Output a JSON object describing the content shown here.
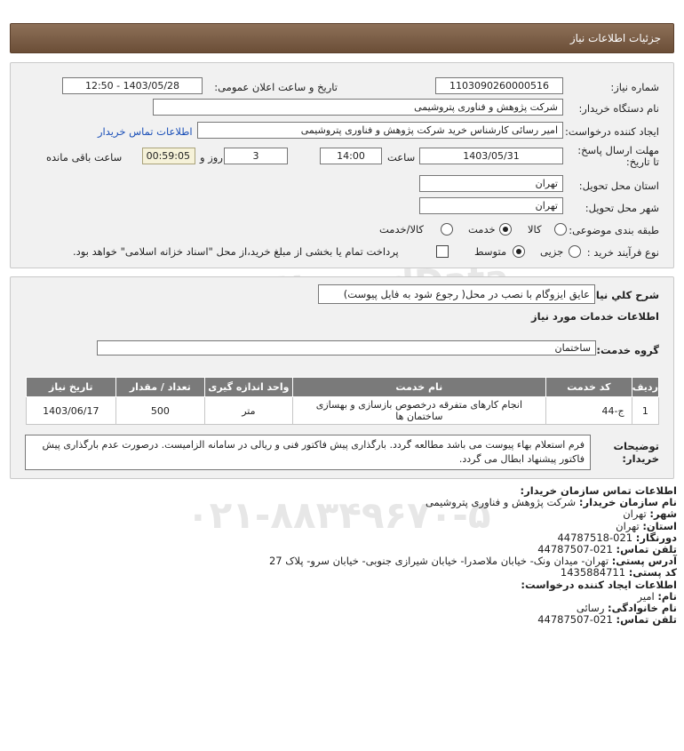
{
  "header": {
    "title": "جزئیات اطلاعات نیاز"
  },
  "form": {
    "need_number_label": "شماره نیاز:",
    "need_number": "1103090260000516",
    "announce_label": "تاریخ و ساعت اعلان عمومی:",
    "announce_value": "1403/05/28 - 12:50",
    "buyer_org_label": "نام دستگاه خریدار:",
    "buyer_org": "شرکت پژوهش و فناوری پتروشیمی",
    "creator_label": "ایجاد کننده درخواست:",
    "creator": "امیر رسائی کارشناس خرید شرکت پژوهش و فناوری پتروشیمی",
    "buyer_contact_link": "اطلاعات تماس خریدار",
    "deadline_label": "مهلت ارسال پاسخ: تا تاریخ:",
    "deadline_date": "1403/05/31",
    "time_label": "ساعت",
    "deadline_time": "14:00",
    "days_value": "3",
    "days_label": "روز و",
    "remaining_time": "00:59:05",
    "remaining_label": "ساعت باقی مانده",
    "province_label": "استان محل تحویل:",
    "province": "تهران",
    "city_label": "شهر محل تحویل:",
    "city": "تهران",
    "category_label": "طبقه بندی موضوعی:",
    "category_options": [
      "کالا",
      "خدمت",
      "کالا/خدمت"
    ],
    "process_label": "نوع فرآیند خرید :",
    "process_options": [
      "جزیی",
      "متوسط"
    ],
    "payment_note": "پرداخت تمام یا بخشی از مبلغ خرید،از محل \"اسناد خزانه اسلامی\" خواهد بود."
  },
  "details": {
    "desc_label": "شرح کلي نياز:",
    "desc_value": "عایق ایزوگام با نصب در محل( رجوع شود به فایل پیوست)",
    "services_heading": "اطلاعات خدمات مورد نیاز",
    "service_group_label": "گروه خدمت:",
    "service_group": "ساختمان",
    "table": {
      "headers": [
        "ردیف",
        "کد خدمت",
        "نام خدمت",
        "واحد اندازه گیری",
        "تعداد / مقدار",
        "تاریخ نیاز"
      ],
      "row": [
        "1",
        "ج-44",
        "انجام کارهای متفرقه درخصوص بازسازی و بهسازی ساختمان ها",
        "متر",
        "500",
        "1403/06/17"
      ]
    },
    "notes_label": "توضیحات خریدار:",
    "notes": "فرم استعلام بهاء پیوست می باشد مطالعه گردد. بارگذاری پیش فاکتور فنی و ریالی در سامانه الزامیست. درصورت عدم بارگذاری پیش فاکتور پیشنهاد ابطال می گردد."
  },
  "contact": {
    "heading": "اطلاعات تماس سازمان خریدار:",
    "org_label": "نام سازمان خریدار:",
    "org": "شرکت پژوهش و فناوری پتروشیمی",
    "city_label": "شهر:",
    "city": "تهران",
    "province_label": "استان:",
    "province": "تهران",
    "fax_label": "دورنگار:",
    "fax": "021-44787518",
    "phone_label": "تلفن تماس:",
    "phone": "021-44787507",
    "address_label": "آدرس پستی:",
    "address": "تهران- میدان ونک- خیابان ملاصدرا- خیابان شیرازی جنوبی- خیابان سرو- پلاک 27",
    "postal_label": "کد پستی:",
    "postal": "1435884711",
    "creator_heading": "اطلاعات ایجاد کننده درخواست:",
    "name_label": "نام:",
    "name": "امیر",
    "family_label": "نام خانوادگی:",
    "family": "رسائی",
    "creator_phone_label": "تلفن تماس:",
    "creator_phone": "021-44787507"
  },
  "watermark": {
    "brand": "ParsNamadData",
    "line1": "پایگاه اطلاع رسانی مناقصه ومزایده",
    "phone": "۰۲۱-۸۸۳۴۹۶۷۰-۵"
  }
}
